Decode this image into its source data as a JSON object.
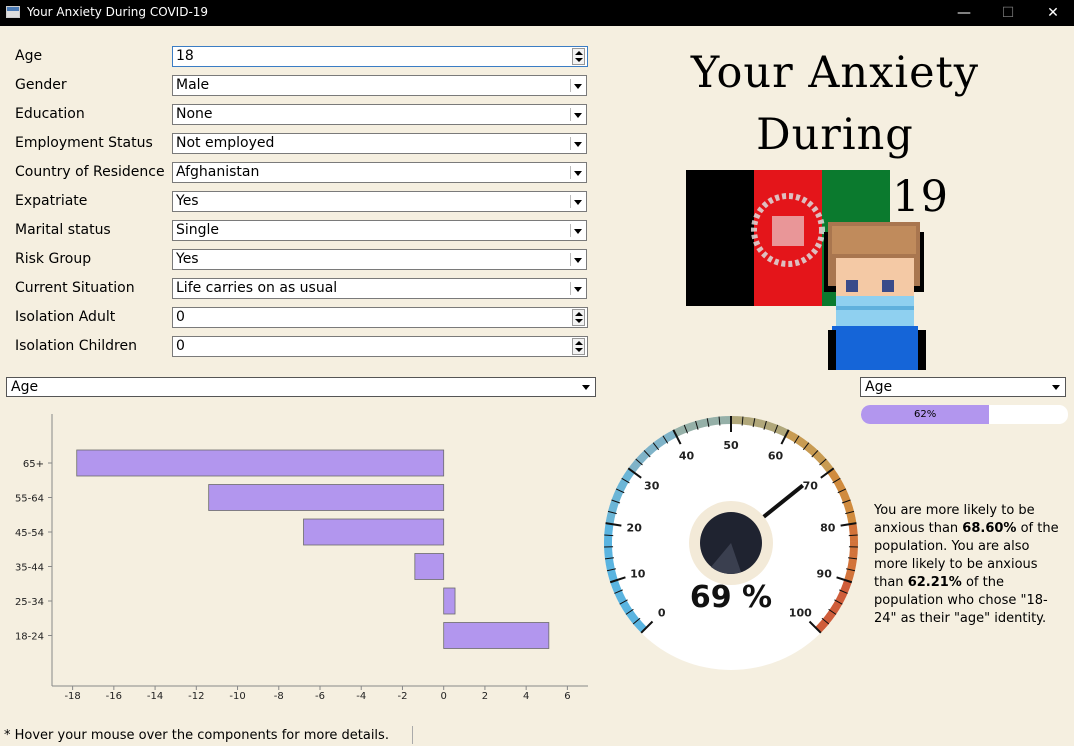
{
  "window": {
    "title": "Your Anxiety During COVID-19",
    "minimize": "—",
    "maximize": "☐",
    "close": "✕"
  },
  "form": {
    "age": {
      "label": "Age",
      "value": "18"
    },
    "gender": {
      "label": "Gender",
      "value": "Male"
    },
    "education": {
      "label": "Education",
      "value": "None"
    },
    "employment": {
      "label": "Employment Status",
      "value": "Not employed"
    },
    "country": {
      "label": "Country of Residence",
      "value": "Afghanistan"
    },
    "expatriate": {
      "label": "Expatriate",
      "value": "Yes"
    },
    "marital": {
      "label": "Marital status",
      "value": "Single"
    },
    "risk": {
      "label": "Risk Group",
      "value": "Yes"
    },
    "situation": {
      "label": "Current Situation",
      "value": "Life carries on as usual"
    },
    "iso_adult": {
      "label": "Isolation Adult",
      "value": "0"
    },
    "iso_children": {
      "label": "Isolation Children",
      "value": "0"
    }
  },
  "header": {
    "title_line1": "Your Anxiety During",
    "title_line2": "COVID-19"
  },
  "chart_selector": {
    "value": "Age"
  },
  "compare_selector": {
    "value": "Age"
  },
  "progress": {
    "value": 0.62,
    "label": "62%",
    "color": "#b296ee"
  },
  "gauge": {
    "value": 69,
    "display": "69 %",
    "ticks": [
      "0",
      "10",
      "20",
      "30",
      "40",
      "50",
      "60",
      "70",
      "80",
      "90",
      "100"
    ]
  },
  "result": {
    "p1": "You are more likely to be anxious than ",
    "v1": "68.60%",
    "p2": " of the population. You are also more likely to be anxious than ",
    "v2": "62.21%",
    "p3": " of the population who chose \"18-24\" as their \"age\" identity."
  },
  "footnote": "* Hover your mouse over the components for more details.",
  "chart_data": {
    "type": "bar",
    "orientation": "horizontal",
    "categories": [
      "65+",
      "55-64",
      "45-54",
      "35-44",
      "25-34",
      "18-24"
    ],
    "values": [
      -17.8,
      -11.4,
      -6.8,
      -1.4,
      0.55,
      5.1
    ],
    "xlim": [
      -19,
      7
    ],
    "xticks": [
      -18,
      -16,
      -14,
      -12,
      -10,
      -8,
      -6,
      -4,
      -2,
      0,
      2,
      4,
      6
    ],
    "bar_color": "#b296ee"
  }
}
